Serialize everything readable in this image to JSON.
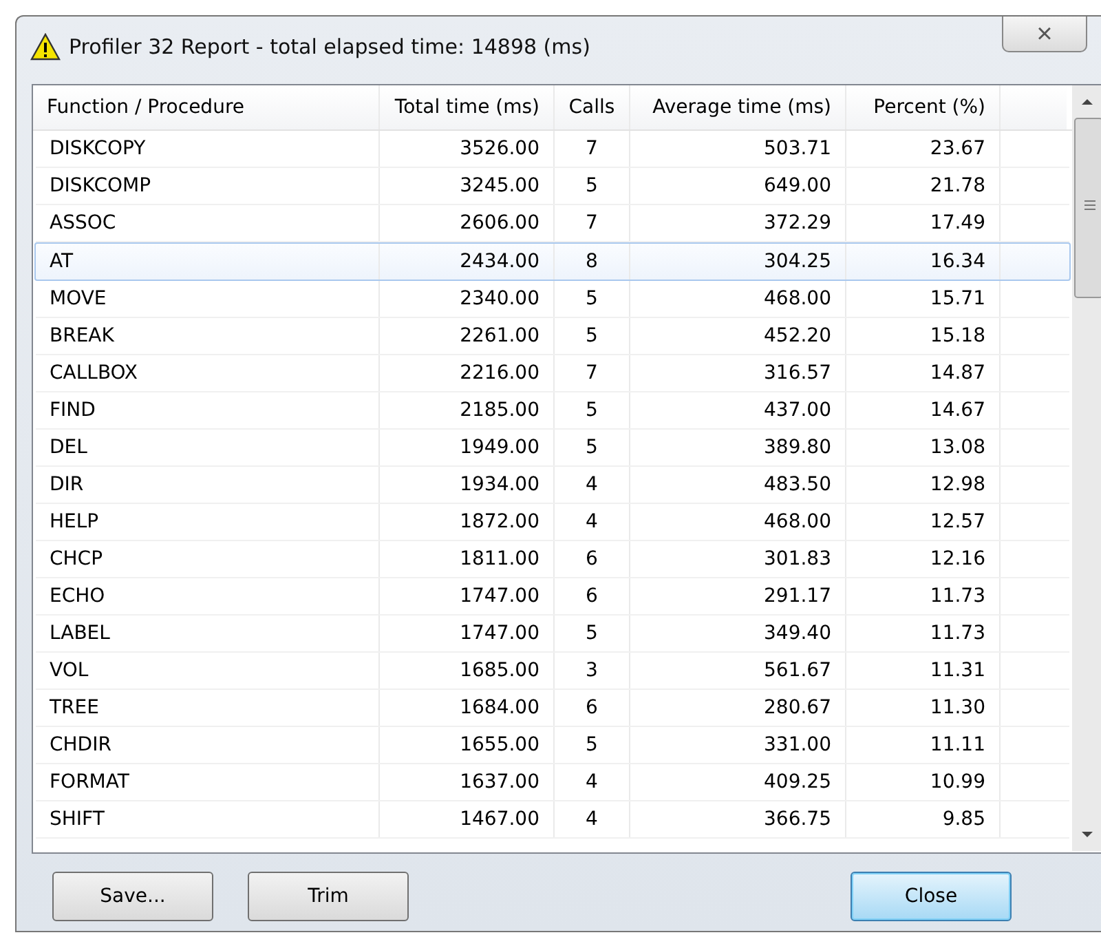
{
  "window": {
    "title": "Profiler 32 Report -  total elapsed time: 14898 (ms)",
    "close": "×"
  },
  "table": {
    "columns": [
      "Function / Procedure",
      "Total time (ms)",
      "Calls",
      "Average time (ms)",
      "Percent (%)"
    ],
    "rows": [
      {
        "cells": [
          "DISKCOPY",
          "3526.00",
          "7",
          "503.71",
          "23.67"
        ],
        "selected": false
      },
      {
        "cells": [
          "DISKCOMP",
          "3245.00",
          "5",
          "649.00",
          "21.78"
        ],
        "selected": false
      },
      {
        "cells": [
          "ASSOC",
          "2606.00",
          "7",
          "372.29",
          "17.49"
        ],
        "selected": false
      },
      {
        "cells": [
          "AT",
          "2434.00",
          "8",
          "304.25",
          "16.34"
        ],
        "selected": true
      },
      {
        "cells": [
          "MOVE",
          "2340.00",
          "5",
          "468.00",
          "15.71"
        ],
        "selected": false
      },
      {
        "cells": [
          "BREAK",
          "2261.00",
          "5",
          "452.20",
          "15.18"
        ],
        "selected": false
      },
      {
        "cells": [
          "CALLBOX",
          "2216.00",
          "7",
          "316.57",
          "14.87"
        ],
        "selected": false
      },
      {
        "cells": [
          "FIND",
          "2185.00",
          "5",
          "437.00",
          "14.67"
        ],
        "selected": false
      },
      {
        "cells": [
          "DEL",
          "1949.00",
          "5",
          "389.80",
          "13.08"
        ],
        "selected": false
      },
      {
        "cells": [
          "DIR",
          "1934.00",
          "4",
          "483.50",
          "12.98"
        ],
        "selected": false
      },
      {
        "cells": [
          "HELP",
          "1872.00",
          "4",
          "468.00",
          "12.57"
        ],
        "selected": false
      },
      {
        "cells": [
          "CHCP",
          "1811.00",
          "6",
          "301.83",
          "12.16"
        ],
        "selected": false
      },
      {
        "cells": [
          "ECHO",
          "1747.00",
          "6",
          "291.17",
          "11.73"
        ],
        "selected": false
      },
      {
        "cells": [
          "LABEL",
          "1747.00",
          "5",
          "349.40",
          "11.73"
        ],
        "selected": false
      },
      {
        "cells": [
          "VOL",
          "1685.00",
          "3",
          "561.67",
          "11.31"
        ],
        "selected": false
      },
      {
        "cells": [
          "TREE",
          "1684.00",
          "6",
          "280.67",
          "11.30"
        ],
        "selected": false
      },
      {
        "cells": [
          "CHDIR",
          "1655.00",
          "5",
          "331.00",
          "11.11"
        ],
        "selected": false
      },
      {
        "cells": [
          "FORMAT",
          "1637.00",
          "4",
          "409.25",
          "10.99"
        ],
        "selected": false
      },
      {
        "cells": [
          "SHIFT",
          "1467.00",
          "4",
          "366.75",
          "9.85"
        ],
        "selected": false
      }
    ]
  },
  "buttons": [
    {
      "label": "Save...",
      "focused": false
    },
    {
      "label": "Trim",
      "focused": false
    },
    {
      "label": "Close",
      "focused": true
    }
  ]
}
